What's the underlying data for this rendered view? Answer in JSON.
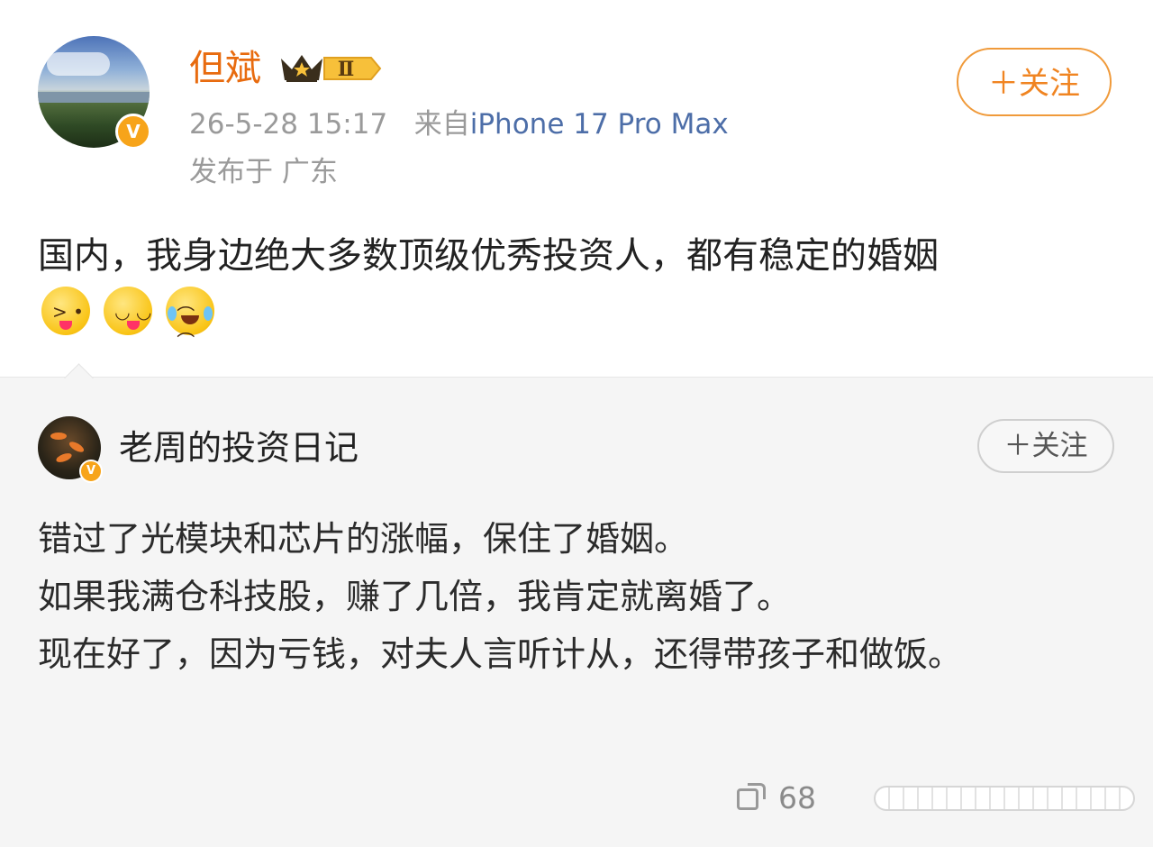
{
  "post": {
    "username": "但斌",
    "rank_badge": "Ⅱ",
    "verified_badge": "V",
    "follow_label": "＋关注",
    "timestamp": "26-5-28 15:17",
    "source_prefix": "来自",
    "device": "iPhone 17 Pro Max",
    "location": "发布于 广东",
    "text": "国内，我身边绝大多数顶级优秀投资人，都有稳定的婚姻",
    "emojis": [
      "tongue-out-emoji",
      "yummy-emoji",
      "laugh-cry-emoji"
    ]
  },
  "repost": {
    "username": "老周的投资日记",
    "verified_badge": "V",
    "follow_label": "＋关注",
    "lines": [
      "错过了光模块和芯片的涨幅，保住了婚姻。",
      "如果我满仓科技股，赚了几倍，我肯定就离婚了。",
      "现在好了，因为亏钱，对夫人言听计从，还得带孩子和做饭。"
    ]
  },
  "footer": {
    "share_count": "68"
  },
  "colors": {
    "username": "#e86b0f",
    "device_link": "#4d6ea8",
    "follow_border": "#f09a3a",
    "repost_bg": "#f5f5f5"
  }
}
